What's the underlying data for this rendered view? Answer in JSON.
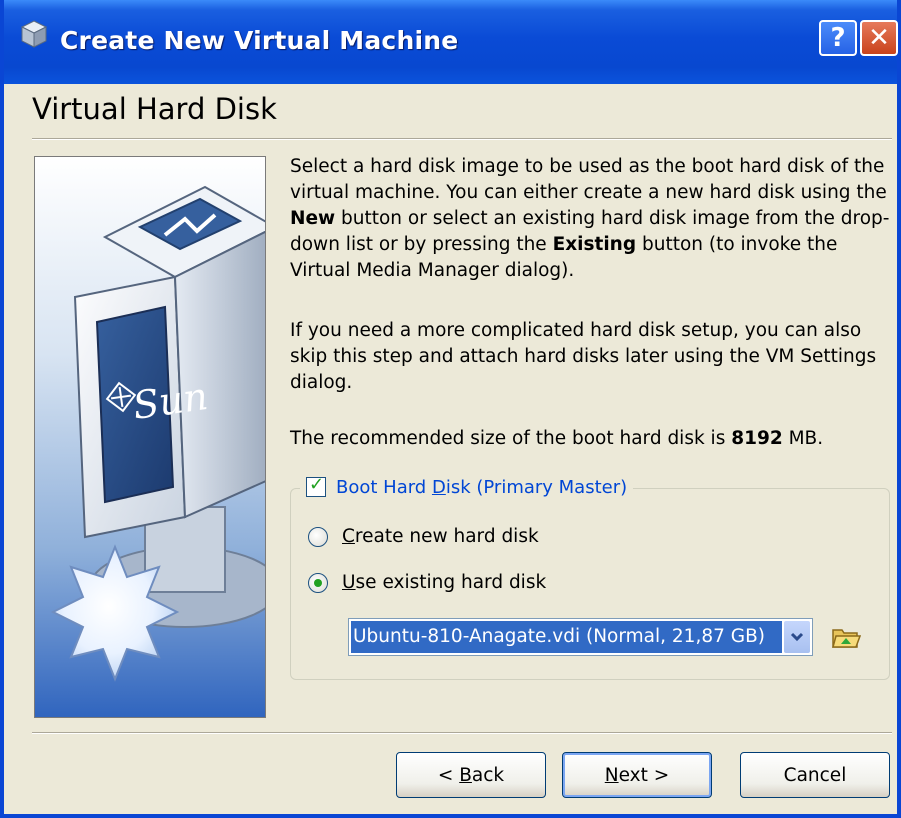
{
  "window": {
    "title": "Create New Virtual Machine",
    "help_label": "?",
    "close_label": "✕"
  },
  "page": {
    "title": "Virtual Hard Disk"
  },
  "description": {
    "p1": {
      "part1": "Select a hard disk image to be used as the boot hard disk of the virtual machine. You can either create a new hard disk using the ",
      "new_bold": "New",
      "part2": " button or select an existing hard disk image from the drop-down list or by pressing the ",
      "existing_bold": "Existing",
      "part3": " button (to invoke the Virtual Media Manager dialog)."
    },
    "p2": "If you need a more complicated hard disk setup, you can also skip this step and attach hard disks later using the VM Settings dialog.",
    "p3": {
      "part1": "The recommended size of the boot hard disk is ",
      "size": "8192",
      "part2": " MB."
    }
  },
  "boot_disk": {
    "legend_pre": "Boot Hard ",
    "legend_accel": "D",
    "legend_post": "isk (Primary Master)",
    "checked": true,
    "options": [
      {
        "accel": "C",
        "rest": "reate new hard disk",
        "selected": false
      },
      {
        "accel": "U",
        "rest": "se existing hard disk",
        "selected": true
      }
    ],
    "selected_disk": "Ubuntu-810-Anagate.vdi (Normal, 21,87 GB)"
  },
  "buttons": {
    "back": {
      "prefix": "< ",
      "accel": "B",
      "rest": "ack"
    },
    "next": {
      "accel": "N",
      "rest": "ext >"
    },
    "cancel": "Cancel"
  },
  "icons": {
    "titlebar": "virtualbox-cube-icon",
    "folder": "open-folder-icon",
    "dropdown": "chevron-down-icon"
  },
  "colors": {
    "titlebar": "#0A4BD6",
    "selection": "#316AC5",
    "legend_text": "#0046D5",
    "check": "#21A121"
  }
}
